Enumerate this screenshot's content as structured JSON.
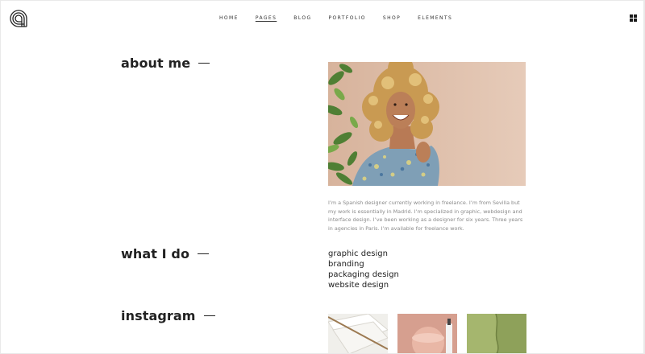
{
  "header": {
    "nav": [
      "HOME",
      "PAGES",
      "BLOG",
      "PORTFOLIO",
      "SHOP",
      "ELEMENTS"
    ],
    "active_nav": "PAGES"
  },
  "sections": {
    "about_title": "about me",
    "what_title": "what I do",
    "instagram_title": "instagram"
  },
  "about": {
    "bio": "I’m a Spanish designer currently working in freelance. I’m from Sevilla but my work is essentially in Madrid. I’m specialized in graphic, webdesign and interface design. I’ve been working as a designer for six years. Three years in agencies in Paris. I’m available for freelance work."
  },
  "services": [
    "graphic design",
    "branding",
    "packaging design",
    "website design"
  ],
  "colors": {
    "accent_text": "#222222",
    "muted_text": "#8a8a8a",
    "portrait_bg": "#ddbca6",
    "insta_1": "#f0efeb",
    "insta_2": "#d69f8f",
    "insta_3": "#8ea15a"
  },
  "icons": {
    "logo": "concentric-arc-logo-icon",
    "menu": "grid-menu-icon"
  }
}
